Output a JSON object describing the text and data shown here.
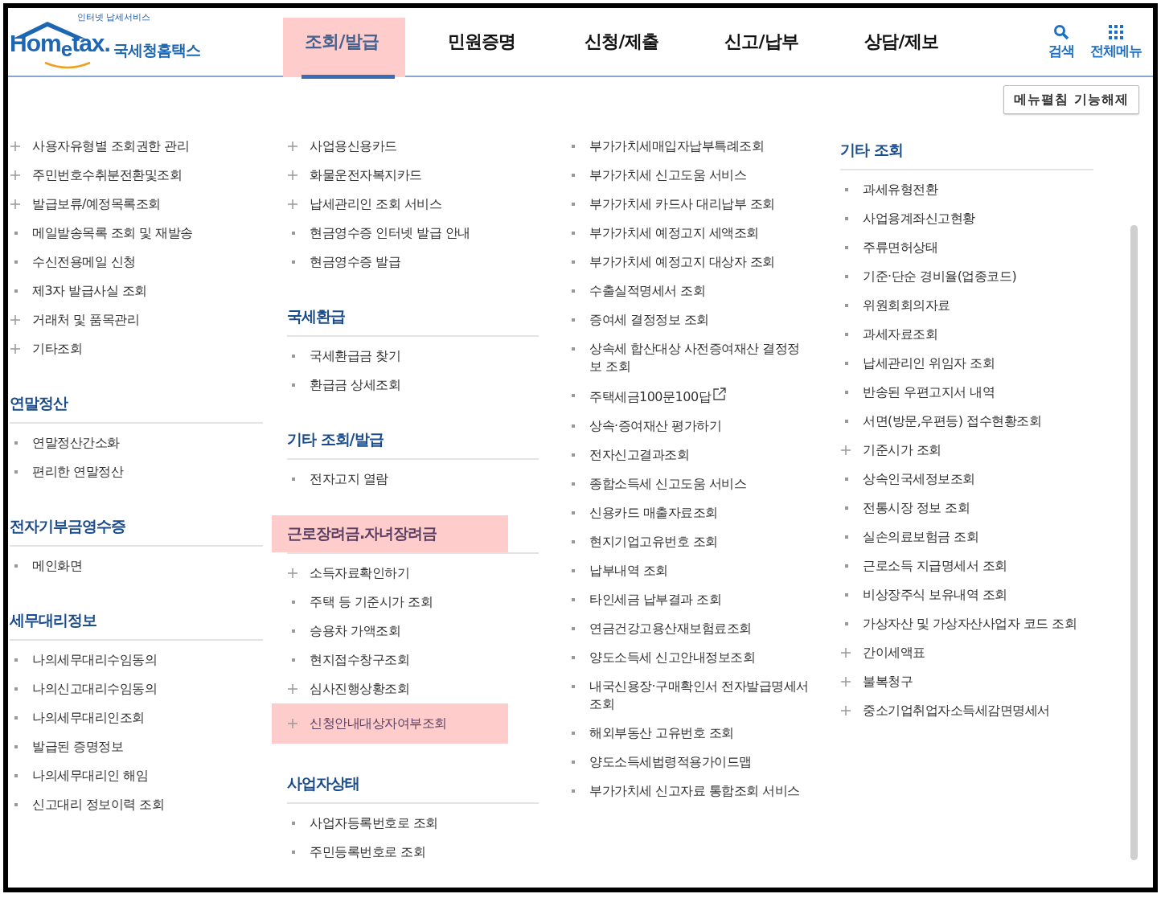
{
  "header": {
    "logo": {
      "tagline": "인터넷 납세서비스",
      "wordmark": "Hom$_{e}$tax.",
      "name": "국세청홈택스"
    },
    "nav": [
      {
        "label": "조회/발급",
        "selected": true
      },
      {
        "label": "민원증명",
        "selected": false
      },
      {
        "label": "신청/제출",
        "selected": false
      },
      {
        "label": "신고/납부",
        "selected": false
      },
      {
        "label": "상담/제보",
        "selected": false
      }
    ],
    "tools": [
      {
        "kind": "search",
        "label": "검색"
      },
      {
        "kind": "grid",
        "label": "전체메뉴"
      }
    ]
  },
  "collapse_button": "메뉴펼침 기능해제",
  "columns": [
    {
      "groups": [
        {
          "items": [
            {
              "kind": "plus",
              "label": "사용자유형별 조회권한 관리",
              "highlighted": false
            },
            {
              "kind": "plus",
              "label": "주민번호수취분전환및조회",
              "highlighted": false
            },
            {
              "kind": "plus",
              "label": "발급보류/예정목록조회",
              "highlighted": false
            },
            {
              "kind": "dot",
              "label": "메일발송목록 조회 및 재발송",
              "highlighted": false
            },
            {
              "kind": "dot",
              "label": "수신전용메일 신청",
              "highlighted": false
            },
            {
              "kind": "dot",
              "label": "제3자 발급사실 조회",
              "highlighted": false
            },
            {
              "kind": "plus",
              "label": "거래처 및 품목관리",
              "highlighted": false
            },
            {
              "kind": "plus",
              "label": "기타조회",
              "highlighted": false
            }
          ]
        },
        {
          "heading": "연말정산",
          "highlighted": false,
          "items": [
            {
              "kind": "dot",
              "label": "연말정산간소화",
              "highlighted": false
            },
            {
              "kind": "dot",
              "label": "편리한 연말정산",
              "highlighted": false
            }
          ]
        },
        {
          "heading": "전자기부금영수증",
          "highlighted": false,
          "items": [
            {
              "kind": "dot",
              "label": "메인화면",
              "highlighted": false
            }
          ]
        },
        {
          "heading": "세무대리정보",
          "highlighted": false,
          "items": [
            {
              "kind": "dot",
              "label": "나의세무대리수임동의",
              "highlighted": false
            },
            {
              "kind": "dot",
              "label": "나의신고대리수임동의",
              "highlighted": false
            },
            {
              "kind": "dot",
              "label": "나의세무대리인조회",
              "highlighted": false
            },
            {
              "kind": "dot",
              "label": "발급된 증명정보",
              "highlighted": false
            },
            {
              "kind": "dot",
              "label": "나의세무대리인 해임",
              "highlighted": false
            },
            {
              "kind": "dot",
              "label": "신고대리 정보이력 조회",
              "highlighted": false
            }
          ]
        }
      ]
    },
    {
      "groups": [
        {
          "items": [
            {
              "kind": "plus",
              "label": "사업용신용카드",
              "highlighted": false
            },
            {
              "kind": "plus",
              "label": "화물운전자복지카드",
              "highlighted": false
            },
            {
              "kind": "plus",
              "label": "납세관리인 조회 서비스",
              "highlighted": false
            },
            {
              "kind": "dot",
              "label": "현금영수증 인터넷 발급 안내",
              "highlighted": false
            },
            {
              "kind": "dot",
              "label": "현금영수증 발급",
              "highlighted": false
            }
          ]
        },
        {
          "heading": "국세환급",
          "highlighted": false,
          "items": [
            {
              "kind": "dot",
              "label": "국세환급금 찾기",
              "highlighted": false
            },
            {
              "kind": "dot",
              "label": "환급금 상세조회",
              "highlighted": false
            }
          ]
        },
        {
          "heading": "기타 조회/발급",
          "highlighted": false,
          "items": [
            {
              "kind": "dot",
              "label": "전자고지 열람",
              "highlighted": false
            }
          ]
        },
        {
          "heading": "근로장려금.자녀장려금",
          "highlighted": true,
          "items": [
            {
              "kind": "plus",
              "label": "소득자료확인하기",
              "highlighted": false
            },
            {
              "kind": "dot",
              "label": "주택 등 기준시가 조회",
              "highlighted": false
            },
            {
              "kind": "dot",
              "label": "승용차 가액조회",
              "highlighted": false
            },
            {
              "kind": "dot",
              "label": "현지접수창구조회",
              "highlighted": false
            },
            {
              "kind": "plus",
              "label": "심사진행상황조회",
              "highlighted": false
            },
            {
              "kind": "plus",
              "label": "신청안내대상자여부조회",
              "highlighted": true
            }
          ]
        },
        {
          "heading": "사업자상태",
          "highlighted": false,
          "items": [
            {
              "kind": "dot",
              "label": "사업자등록번호로 조회",
              "highlighted": false
            },
            {
              "kind": "dot",
              "label": "주민등록번호로 조회",
              "highlighted": false
            }
          ]
        }
      ]
    },
    {
      "groups": [
        {
          "items": [
            {
              "kind": "dot",
              "label": "부가가치세매입자납부특례조회",
              "highlighted": false
            },
            {
              "kind": "dot",
              "label": "부가가치세 신고도움 서비스",
              "highlighted": false
            },
            {
              "kind": "dot",
              "label": "부가가치세 카드사 대리납부 조회",
              "highlighted": false
            },
            {
              "kind": "dot",
              "label": "부가가치세 예정고지 세액조회",
              "highlighted": false
            },
            {
              "kind": "dot",
              "label": "부가가치세 예정고지 대상자 조회",
              "highlighted": false
            },
            {
              "kind": "dot",
              "label": "수출실적명세서 조회",
              "highlighted": false
            },
            {
              "kind": "dot",
              "label": "증여세 결정정보 조회",
              "highlighted": false
            },
            {
              "kind": "dot",
              "label": "상속세 합산대상 사전증여재산 결정정보 조회",
              "highlighted": false
            },
            {
              "kind": "dot",
              "label": "주택세금100문100답",
              "highlighted": false,
              "external": true
            },
            {
              "kind": "dot",
              "label": "상속·증여재산 평가하기",
              "highlighted": false
            },
            {
              "kind": "dot",
              "label": "전자신고결과조회",
              "highlighted": false
            },
            {
              "kind": "dot",
              "label": "종합소득세 신고도움 서비스",
              "highlighted": false
            },
            {
              "kind": "dot",
              "label": "신용카드 매출자료조회",
              "highlighted": false
            },
            {
              "kind": "dot",
              "label": "현지기업고유번호 조회",
              "highlighted": false
            },
            {
              "kind": "dot",
              "label": "납부내역 조회",
              "highlighted": false
            },
            {
              "kind": "dot",
              "label": "타인세금 납부결과 조회",
              "highlighted": false
            },
            {
              "kind": "dot",
              "label": "연금건강고용산재보험료조회",
              "highlighted": false
            },
            {
              "kind": "dot",
              "label": "양도소득세 신고안내정보조회",
              "highlighted": false
            },
            {
              "kind": "dot",
              "label": "내국신용장·구매확인서 전자발급명세서 조회",
              "highlighted": false
            },
            {
              "kind": "dot",
              "label": "해외부동산 고유번호 조회",
              "highlighted": false
            },
            {
              "kind": "dot",
              "label": "양도소득세법령적용가이드맵",
              "highlighted": false
            },
            {
              "kind": "dot",
              "label": "부가가치세 신고자료 통합조회 서비스",
              "highlighted": false
            }
          ]
        }
      ]
    },
    {
      "groups": [
        {
          "heading": "기타 조회",
          "highlighted": false,
          "items": [
            {
              "kind": "dot",
              "label": "과세유형전환",
              "highlighted": false
            },
            {
              "kind": "dot",
              "label": "사업용계좌신고현황",
              "highlighted": false
            },
            {
              "kind": "dot",
              "label": "주류면허상태",
              "highlighted": false
            },
            {
              "kind": "dot",
              "label": "기준·단순 경비율(업종코드)",
              "highlighted": false
            },
            {
              "kind": "dot",
              "label": "위원회회의자료",
              "highlighted": false
            },
            {
              "kind": "dot",
              "label": "과세자료조회",
              "highlighted": false
            },
            {
              "kind": "dot",
              "label": "납세관리인 위임자 조회",
              "highlighted": false
            },
            {
              "kind": "dot",
              "label": "반송된 우편고지서 내역",
              "highlighted": false
            },
            {
              "kind": "dot",
              "label": "서면(방문,우편등) 접수현황조회",
              "highlighted": false
            },
            {
              "kind": "plus",
              "label": "기준시가 조회",
              "highlighted": false
            },
            {
              "kind": "dot",
              "label": "상속인국세정보조회",
              "highlighted": false
            },
            {
              "kind": "dot",
              "label": "전통시장 정보 조회",
              "highlighted": false
            },
            {
              "kind": "dot",
              "label": "실손의료보험금 조회",
              "highlighted": false
            },
            {
              "kind": "dot",
              "label": "근로소득 지급명세서 조회",
              "highlighted": false
            },
            {
              "kind": "dot",
              "label": "비상장주식 보유내역 조회",
              "highlighted": false
            },
            {
              "kind": "dot",
              "label": "가상자산 및 가상자산사업자 코드 조회",
              "highlighted": false
            },
            {
              "kind": "plus",
              "label": "간이세액표",
              "highlighted": false
            },
            {
              "kind": "plus",
              "label": "불복청구",
              "highlighted": false
            },
            {
              "kind": "plus",
              "label": "중소기업취업자소득세감면명세서",
              "highlighted": false
            }
          ]
        }
      ]
    }
  ]
}
